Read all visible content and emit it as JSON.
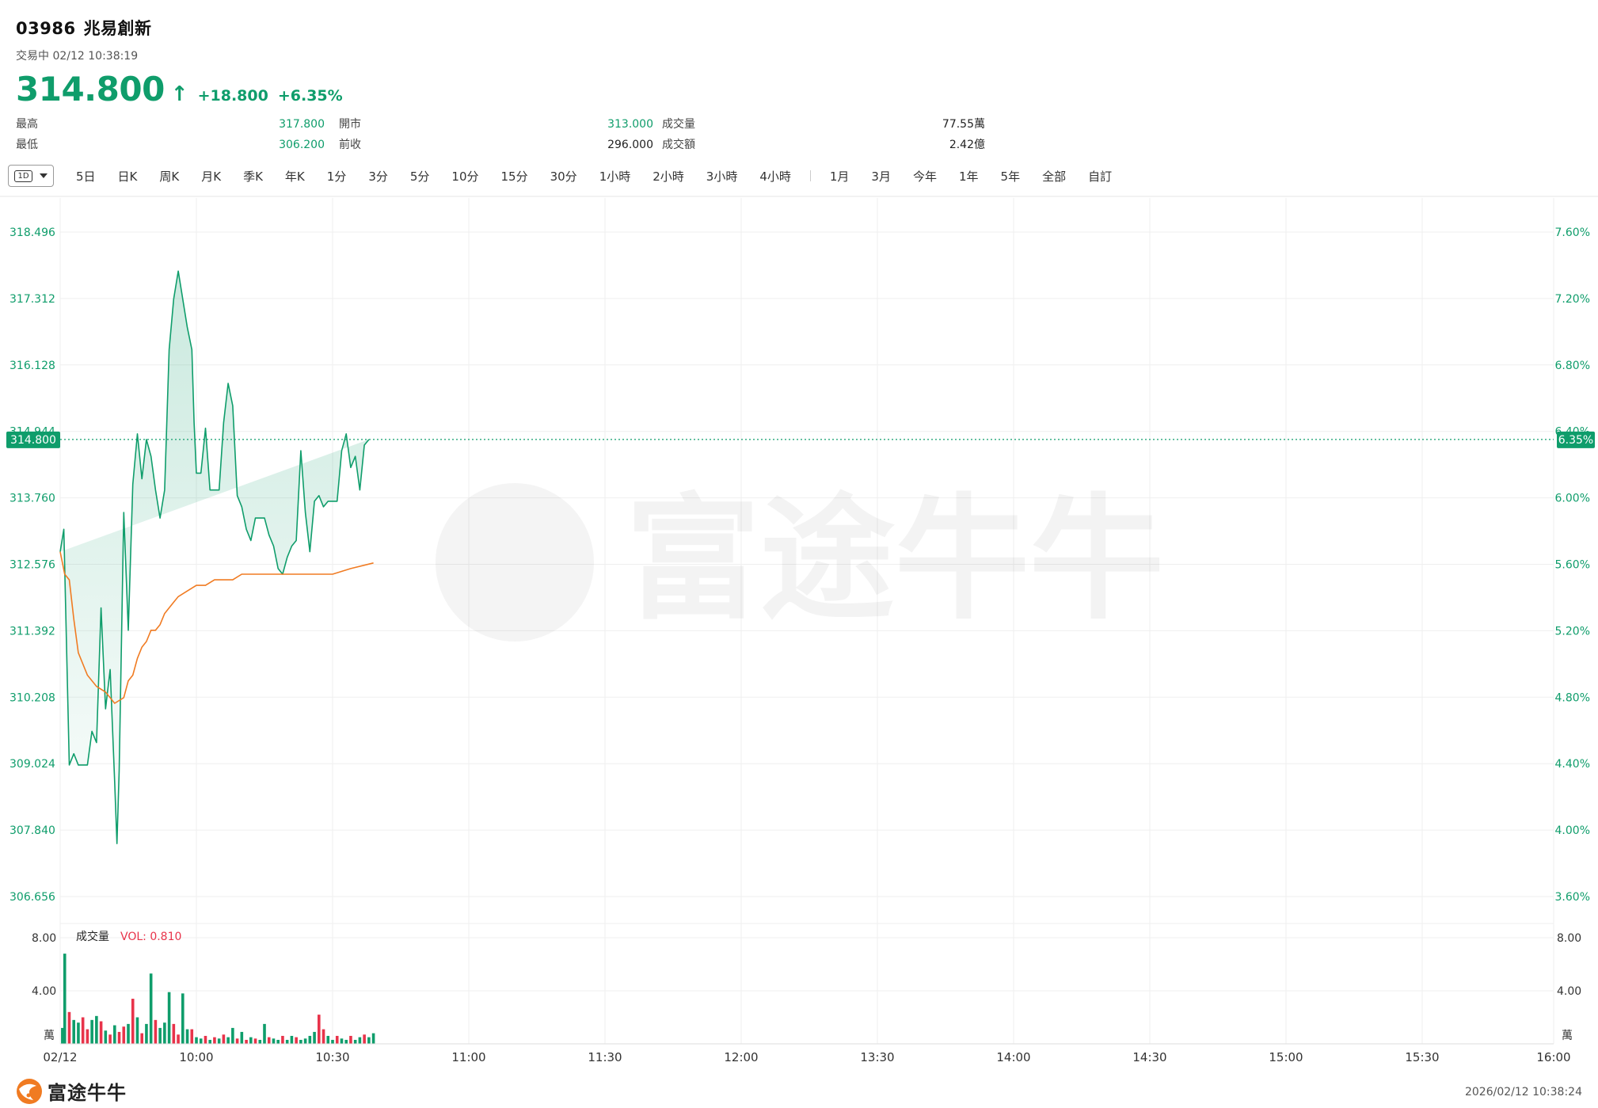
{
  "stock": {
    "code": "03986",
    "name": "兆易創新"
  },
  "status": {
    "state": "交易中",
    "datetime": "02/12 10:38:19"
  },
  "quote": {
    "price": "314.800",
    "change": "+18.800",
    "change_pct": "+6.35%"
  },
  "stats": [
    [
      {
        "label": "最高",
        "value": "317.800"
      },
      {
        "label": "開市",
        "value": "313.000"
      },
      {
        "label": "成交量",
        "value": "77.55萬"
      }
    ],
    [
      {
        "label": "最低",
        "value": "306.200"
      },
      {
        "label": "前收",
        "value": "296.000"
      },
      {
        "label": "成交額",
        "value": "2.42億"
      }
    ]
  ],
  "toolbar": {
    "selected": "1D",
    "tabs": [
      "5日",
      "日K",
      "周K",
      "月K",
      "季K",
      "年K",
      "1分",
      "3分",
      "5分",
      "10分",
      "15分",
      "30分",
      "1小時",
      "2小時",
      "3小時",
      "4小時"
    ],
    "tabs2": [
      "1月",
      "3月",
      "今年",
      "1年",
      "5年",
      "全部",
      "自訂"
    ]
  },
  "colors": {
    "up": "#0f9d6b",
    "down": "#e8334a",
    "avg": "#f07b22"
  },
  "chart_data": {
    "type": "line",
    "x_labels": [
      "02/12",
      "10:00",
      "10:30",
      "11:00",
      "11:30",
      "12:00",
      "13:30",
      "14:00",
      "14:30",
      "15:00",
      "15:30",
      "16:00"
    ],
    "price_axis": {
      "ticks": [
        "318.496",
        "317.312",
        "316.128",
        "314.944",
        "313.760",
        "312.576",
        "311.392",
        "310.208",
        "309.024",
        "307.840",
        "306.656"
      ],
      "ylim": [
        306.656,
        318.496
      ]
    },
    "pct_axis": {
      "ticks": [
        "7.60%",
        "7.20%",
        "6.80%",
        "6.40%",
        "6.00%",
        "5.60%",
        "5.20%",
        "4.80%",
        "4.40%",
        "4.00%",
        "3.60%"
      ]
    },
    "current": {
      "price": 314.8,
      "price_label": "314.800",
      "pct_label": "6.35%"
    },
    "price_series": {
      "name": "",
      "minutes": [
        0,
        0.8,
        2,
        3,
        4,
        5,
        6,
        7,
        8,
        9,
        10,
        11,
        12,
        12.5,
        13,
        14,
        15,
        16,
        17,
        18,
        19,
        20,
        21,
        22,
        23,
        24,
        25,
        26,
        27,
        28,
        29,
        29.5,
        30,
        31,
        32,
        33,
        34,
        35,
        36,
        37,
        38,
        39,
        40,
        41,
        42,
        43,
        44,
        45,
        46,
        47,
        48,
        49,
        50,
        51,
        52,
        53,
        54,
        55,
        56,
        57,
        58,
        59,
        60,
        61,
        62,
        63,
        64,
        65,
        66,
        67,
        68,
        69
      ],
      "values": [
        312.8,
        313.2,
        309.0,
        309.2,
        309.0,
        309.0,
        309.0,
        309.6,
        309.4,
        311.8,
        310.0,
        310.7,
        308.7,
        307.6,
        308.9,
        313.5,
        311.4,
        314.0,
        314.9,
        314.1,
        314.8,
        314.5,
        313.9,
        313.4,
        313.9,
        316.4,
        317.3,
        317.8,
        317.3,
        316.8,
        316.4,
        315.1,
        314.2,
        314.2,
        315.0,
        313.9,
        313.9,
        313.9,
        315.1,
        315.8,
        315.4,
        313.8,
        313.6,
        313.2,
        313.0,
        313.4,
        313.4,
        313.4,
        313.1,
        312.9,
        312.5,
        312.4,
        312.7,
        312.9,
        313.0,
        314.6,
        313.5,
        312.8,
        313.7,
        313.8,
        313.6,
        313.7,
        313.7,
        313.7,
        314.6,
        314.9,
        314.3,
        314.5,
        313.9,
        314.7,
        314.8
      ]
    },
    "avg_series": {
      "name": "",
      "minutes": [
        0,
        1,
        2,
        3,
        4,
        6,
        8,
        10,
        12,
        14,
        15,
        16,
        17,
        18,
        19,
        20,
        21,
        22,
        23,
        24,
        25,
        26,
        28,
        30,
        32,
        34,
        36,
        38,
        40,
        44,
        50,
        56,
        60,
        64,
        69
      ],
      "values": [
        312.8,
        312.4,
        312.3,
        311.6,
        311.0,
        310.6,
        310.4,
        310.3,
        310.1,
        310.2,
        310.5,
        310.6,
        310.9,
        311.1,
        311.2,
        311.4,
        311.4,
        311.5,
        311.7,
        311.8,
        311.9,
        312.0,
        312.1,
        312.2,
        312.2,
        312.3,
        312.3,
        312.3,
        312.4,
        312.4,
        312.4,
        312.4,
        312.4,
        312.5,
        312.6
      ]
    },
    "volume": {
      "label": "成交量",
      "vol_label": "VOL: 0.810",
      "ticks": [
        "8.00",
        "4.00"
      ],
      "unit": "萬",
      "ylim": [
        0,
        8
      ],
      "bars": [
        {
          "m": 0.5,
          "v": 1.2,
          "d": "up"
        },
        {
          "m": 1,
          "v": 6.8,
          "d": "up"
        },
        {
          "m": 2,
          "v": 2.4,
          "d": "down"
        },
        {
          "m": 3,
          "v": 1.8,
          "d": "up"
        },
        {
          "m": 4,
          "v": 1.6,
          "d": "up"
        },
        {
          "m": 5,
          "v": 2.0,
          "d": "down"
        },
        {
          "m": 6,
          "v": 1.1,
          "d": "down"
        },
        {
          "m": 7,
          "v": 1.8,
          "d": "up"
        },
        {
          "m": 8,
          "v": 2.1,
          "d": "up"
        },
        {
          "m": 9,
          "v": 1.7,
          "d": "down"
        },
        {
          "m": 10,
          "v": 1.0,
          "d": "up"
        },
        {
          "m": 11,
          "v": 0.7,
          "d": "down"
        },
        {
          "m": 12,
          "v": 1.4,
          "d": "up"
        },
        {
          "m": 13,
          "v": 0.9,
          "d": "down"
        },
        {
          "m": 14,
          "v": 1.3,
          "d": "down"
        },
        {
          "m": 15,
          "v": 1.5,
          "d": "up"
        },
        {
          "m": 16,
          "v": 3.4,
          "d": "down"
        },
        {
          "m": 17,
          "v": 2.0,
          "d": "up"
        },
        {
          "m": 18,
          "v": 0.8,
          "d": "down"
        },
        {
          "m": 19,
          "v": 1.5,
          "d": "up"
        },
        {
          "m": 20,
          "v": 5.3,
          "d": "up"
        },
        {
          "m": 21,
          "v": 1.8,
          "d": "down"
        },
        {
          "m": 22,
          "v": 1.2,
          "d": "up"
        },
        {
          "m": 23,
          "v": 1.6,
          "d": "up"
        },
        {
          "m": 24,
          "v": 3.9,
          "d": "up"
        },
        {
          "m": 25,
          "v": 1.5,
          "d": "down"
        },
        {
          "m": 26,
          "v": 0.7,
          "d": "down"
        },
        {
          "m": 27,
          "v": 3.8,
          "d": "up"
        },
        {
          "m": 28,
          "v": 1.1,
          "d": "up"
        },
        {
          "m": 29,
          "v": 1.1,
          "d": "down"
        },
        {
          "m": 30,
          "v": 0.5,
          "d": "up"
        },
        {
          "m": 31,
          "v": 0.4,
          "d": "up"
        },
        {
          "m": 32,
          "v": 0.6,
          "d": "down"
        },
        {
          "m": 33,
          "v": 0.3,
          "d": "up"
        },
        {
          "m": 34,
          "v": 0.5,
          "d": "down"
        },
        {
          "m": 35,
          "v": 0.4,
          "d": "up"
        },
        {
          "m": 36,
          "v": 0.7,
          "d": "down"
        },
        {
          "m": 37,
          "v": 0.5,
          "d": "up"
        },
        {
          "m": 38,
          "v": 1.2,
          "d": "up"
        },
        {
          "m": 39,
          "v": 0.4,
          "d": "down"
        },
        {
          "m": 40,
          "v": 0.9,
          "d": "up"
        },
        {
          "m": 41,
          "v": 0.3,
          "d": "down"
        },
        {
          "m": 42,
          "v": 0.5,
          "d": "up"
        },
        {
          "m": 43,
          "v": 0.4,
          "d": "down"
        },
        {
          "m": 44,
          "v": 0.3,
          "d": "up"
        },
        {
          "m": 45,
          "v": 1.5,
          "d": "up"
        },
        {
          "m": 46,
          "v": 0.5,
          "d": "down"
        },
        {
          "m": 47,
          "v": 0.4,
          "d": "up"
        },
        {
          "m": 48,
          "v": 0.3,
          "d": "up"
        },
        {
          "m": 49,
          "v": 0.6,
          "d": "down"
        },
        {
          "m": 50,
          "v": 0.3,
          "d": "up"
        },
        {
          "m": 51,
          "v": 0.6,
          "d": "up"
        },
        {
          "m": 52,
          "v": 0.5,
          "d": "down"
        },
        {
          "m": 53,
          "v": 0.3,
          "d": "up"
        },
        {
          "m": 54,
          "v": 0.4,
          "d": "up"
        },
        {
          "m": 55,
          "v": 0.6,
          "d": "up"
        },
        {
          "m": 56,
          "v": 0.9,
          "d": "up"
        },
        {
          "m": 57,
          "v": 2.2,
          "d": "down"
        },
        {
          "m": 58,
          "v": 1.1,
          "d": "down"
        },
        {
          "m": 59,
          "v": 0.6,
          "d": "up"
        },
        {
          "m": 60,
          "v": 0.3,
          "d": "up"
        },
        {
          "m": 61,
          "v": 0.6,
          "d": "down"
        },
        {
          "m": 62,
          "v": 0.4,
          "d": "up"
        },
        {
          "m": 63,
          "v": 0.3,
          "d": "up"
        },
        {
          "m": 64,
          "v": 0.6,
          "d": "down"
        },
        {
          "m": 65,
          "v": 0.3,
          "d": "up"
        },
        {
          "m": 66,
          "v": 0.5,
          "d": "up"
        },
        {
          "m": 67,
          "v": 0.7,
          "d": "down"
        },
        {
          "m": 68,
          "v": 0.5,
          "d": "up"
        },
        {
          "m": 69,
          "v": 0.8,
          "d": "up"
        }
      ]
    },
    "grid": true
  },
  "watermark": {
    "text": "富途牛牛"
  },
  "footer": {
    "brand": "富途牛牛",
    "datetime": "2026/02/12 10:38:24"
  }
}
